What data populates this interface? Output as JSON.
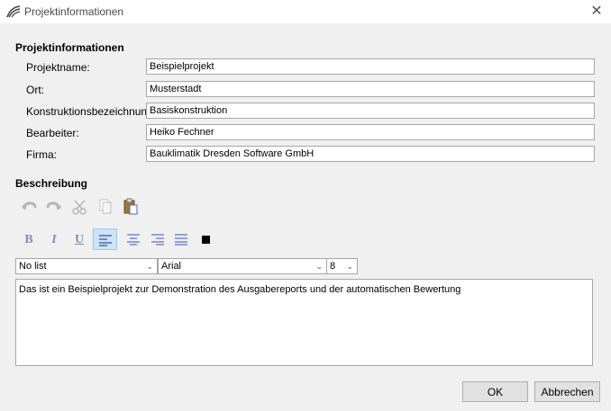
{
  "window": {
    "title": "Projektinformationen",
    "close_symbol": "✕"
  },
  "project_section": {
    "heading": "Projektinformationen",
    "fields": [
      {
        "label": "Projektname:",
        "value": "Beispielprojekt"
      },
      {
        "label": "Ort:",
        "value": "Musterstadt"
      },
      {
        "label": "Konstruktionsbezeichnung:",
        "value": "Basiskonstruktion"
      },
      {
        "label": "Bearbeiter:",
        "value": "Heiko Fechner"
      },
      {
        "label": "Firma:",
        "value": "Bauklimatik Dresden Software GmbH"
      }
    ]
  },
  "description_section": {
    "heading": "Beschreibung",
    "edit_icons": [
      "undo-icon",
      "redo-icon",
      "cut-icon",
      "copy-icon",
      "paste-icon"
    ],
    "format_buttons": [
      {
        "icon": "bold-icon",
        "glyph": "B"
      },
      {
        "icon": "italic-icon",
        "glyph": "I"
      },
      {
        "icon": "underline-icon",
        "glyph": "U"
      },
      {
        "icon": "align-left-icon",
        "active": true
      },
      {
        "icon": "align-center-icon"
      },
      {
        "icon": "align-right-icon"
      },
      {
        "icon": "align-justify-icon"
      },
      {
        "icon": "text-color-icon",
        "color": "#000000"
      }
    ],
    "list_style": "No list",
    "font_family": "Arial",
    "font_size": "8",
    "text": "Das ist ein Beispielprojekt zur Demonstration des Ausgabereports und der automatischen Bewertung"
  },
  "buttons": {
    "ok": "OK",
    "cancel": "Abbrechen"
  },
  "colors": {
    "accent": "#cce4f7",
    "button_bg": "#e1e1e1"
  }
}
